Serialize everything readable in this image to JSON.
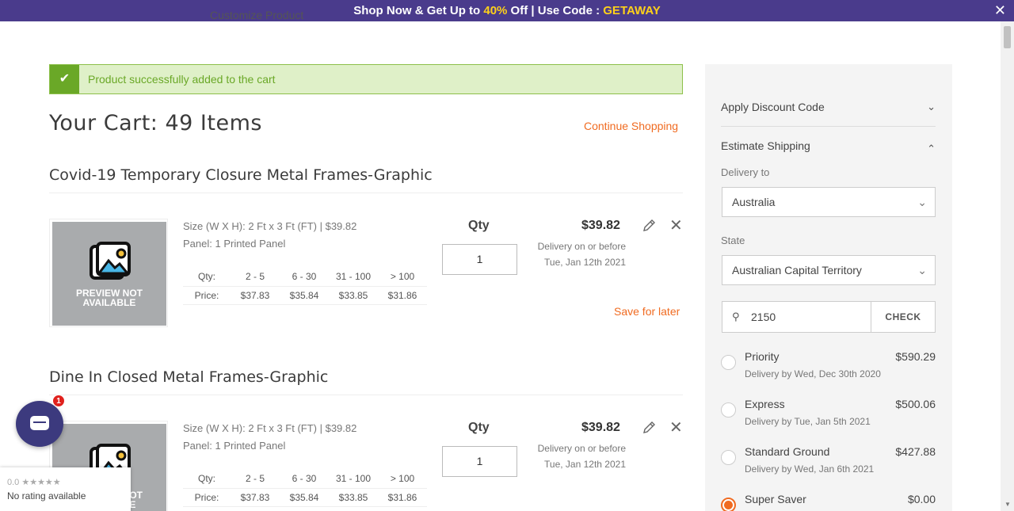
{
  "promo": {
    "prefix": "Shop Now & Get Up to ",
    "percent": "40%",
    "mid": " Off | Use Code : ",
    "code": "GETAWAY",
    "close": "✕"
  },
  "crumb": "Customize Product",
  "alert": {
    "message": "Product successfully added to the cart"
  },
  "cart": {
    "title": "Your Cart: 49 Items",
    "continue": "Continue Shopping"
  },
  "items": [
    {
      "name": "Covid-19 Temporary Closure Metal Frames-Graphic",
      "size": "Size (W X H): 2 Ft x 3 Ft (FT) | $39.82",
      "panel": "Panel: 1 Printed Panel",
      "preview": "PREVIEW NOT AVAILABLE",
      "tiers": {
        "qty_label": "Qty:",
        "price_label": "Price:",
        "qty": [
          "2 - 5",
          "6 - 30",
          "31 - 100",
          "> 100"
        ],
        "price": [
          "$37.83",
          "$35.84",
          "$33.85",
          "$31.86"
        ]
      },
      "qty_label": "Qty",
      "qty": "1",
      "price": "$39.82",
      "delivery_line1": "Delivery on or before",
      "delivery_line2": "Tue, Jan 12th 2021",
      "save_later": "Save for later"
    },
    {
      "name": "Dine In Closed Metal Frames-Graphic",
      "size": "Size (W X H): 2 Ft x 3 Ft (FT) | $39.82",
      "panel": "Panel: 1 Printed Panel",
      "preview": "PREVIEW NOT AVAILABLE",
      "tiers": {
        "qty_label": "Qty:",
        "price_label": "Price:",
        "qty": [
          "2 - 5",
          "6 - 30",
          "31 - 100",
          "> 100"
        ],
        "price": [
          "$37.83",
          "$35.84",
          "$33.85",
          "$31.86"
        ]
      },
      "qty_label": "Qty",
      "qty": "1",
      "price": "$39.82",
      "delivery_line1": "Delivery on or before",
      "delivery_line2": "Tue, Jan 12th 2021"
    }
  ],
  "sidebar": {
    "discount": "Apply Discount Code",
    "shipping": "Estimate Shipping",
    "delivery_to_label": "Delivery to",
    "country": "Australia",
    "state_label": "State",
    "state": "Australian Capital Territory",
    "zip": "2150",
    "check": "CHECK",
    "options": [
      {
        "name": "Priority",
        "date": "Delivery by Wed, Dec 30th 2020",
        "price": "$590.29",
        "selected": false
      },
      {
        "name": "Express",
        "date": "Delivery by Tue, Jan 5th 2021",
        "price": "$500.06",
        "selected": false
      },
      {
        "name": "Standard Ground",
        "date": "Delivery by Wed, Jan 6th 2021",
        "price": "$427.88",
        "selected": false
      },
      {
        "name": "Super Saver",
        "date": "",
        "price": "$0.00",
        "selected": true
      }
    ]
  },
  "chat": {
    "badge": "1"
  },
  "rating": {
    "stars": "0.0 ★★★★★",
    "text": "No rating available"
  },
  "colors": {
    "accent": "#f06b21",
    "promo_bg": "#4a3b8c",
    "success": "#6aa827"
  }
}
